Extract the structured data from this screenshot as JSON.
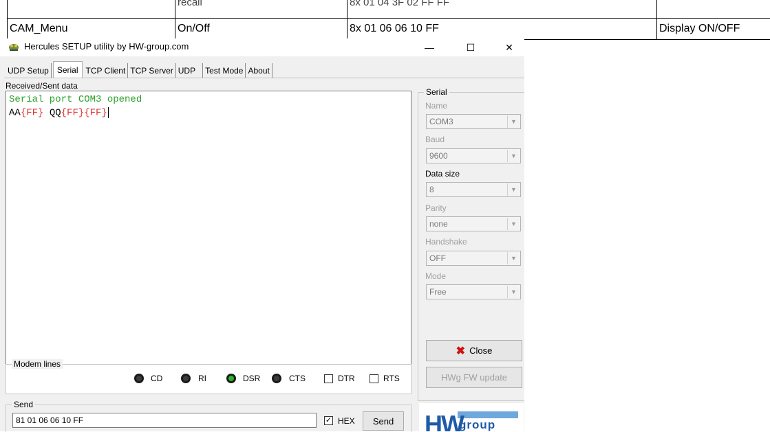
{
  "doc": {
    "top_row": [
      "recall",
      "8x 01 04 3F 02 FF FF"
    ],
    "main_row": [
      "CAM_Menu",
      "On/Off",
      "8x 01 06 06 10 FF",
      "Display ON/OFF"
    ]
  },
  "window": {
    "title": "Hercules SETUP utility by HW-group.com",
    "min": "—",
    "max": "☐",
    "close": "✕"
  },
  "tabs": [
    "UDP Setup",
    "Serial",
    "TCP Client",
    "TCP Server",
    "UDP",
    "Test Mode",
    "About"
  ],
  "received": {
    "label": "Received/Sent data",
    "line1": "Serial port COM3 opened",
    "line2_parts": [
      "AA",
      "{FF}",
      " QQ",
      "{FF}",
      "{FF}"
    ]
  },
  "serial": {
    "group_title": "Serial",
    "name_label": "Name",
    "name_value": "COM3",
    "baud_label": "Baud",
    "baud_value": "9600",
    "datasize_label": "Data size",
    "datasize_value": "8",
    "parity_label": "Parity",
    "parity_value": "none",
    "handshake_label": "Handshake",
    "handshake_value": "OFF",
    "mode_label": "Mode",
    "mode_value": "Free",
    "close_label": "Close",
    "fw_label": "HWg FW update"
  },
  "modem": {
    "title": "Modem lines",
    "cd": "CD",
    "ri": "RI",
    "dsr": "DSR",
    "cts": "CTS",
    "dtr": "DTR",
    "rts": "RTS"
  },
  "send": {
    "title": "Send",
    "value": "81 01 06 06 10 FF",
    "hex_label": "HEX",
    "hex_checked": "✓",
    "button": "Send"
  },
  "logo": {
    "hw": "HW",
    "group": "group"
  }
}
